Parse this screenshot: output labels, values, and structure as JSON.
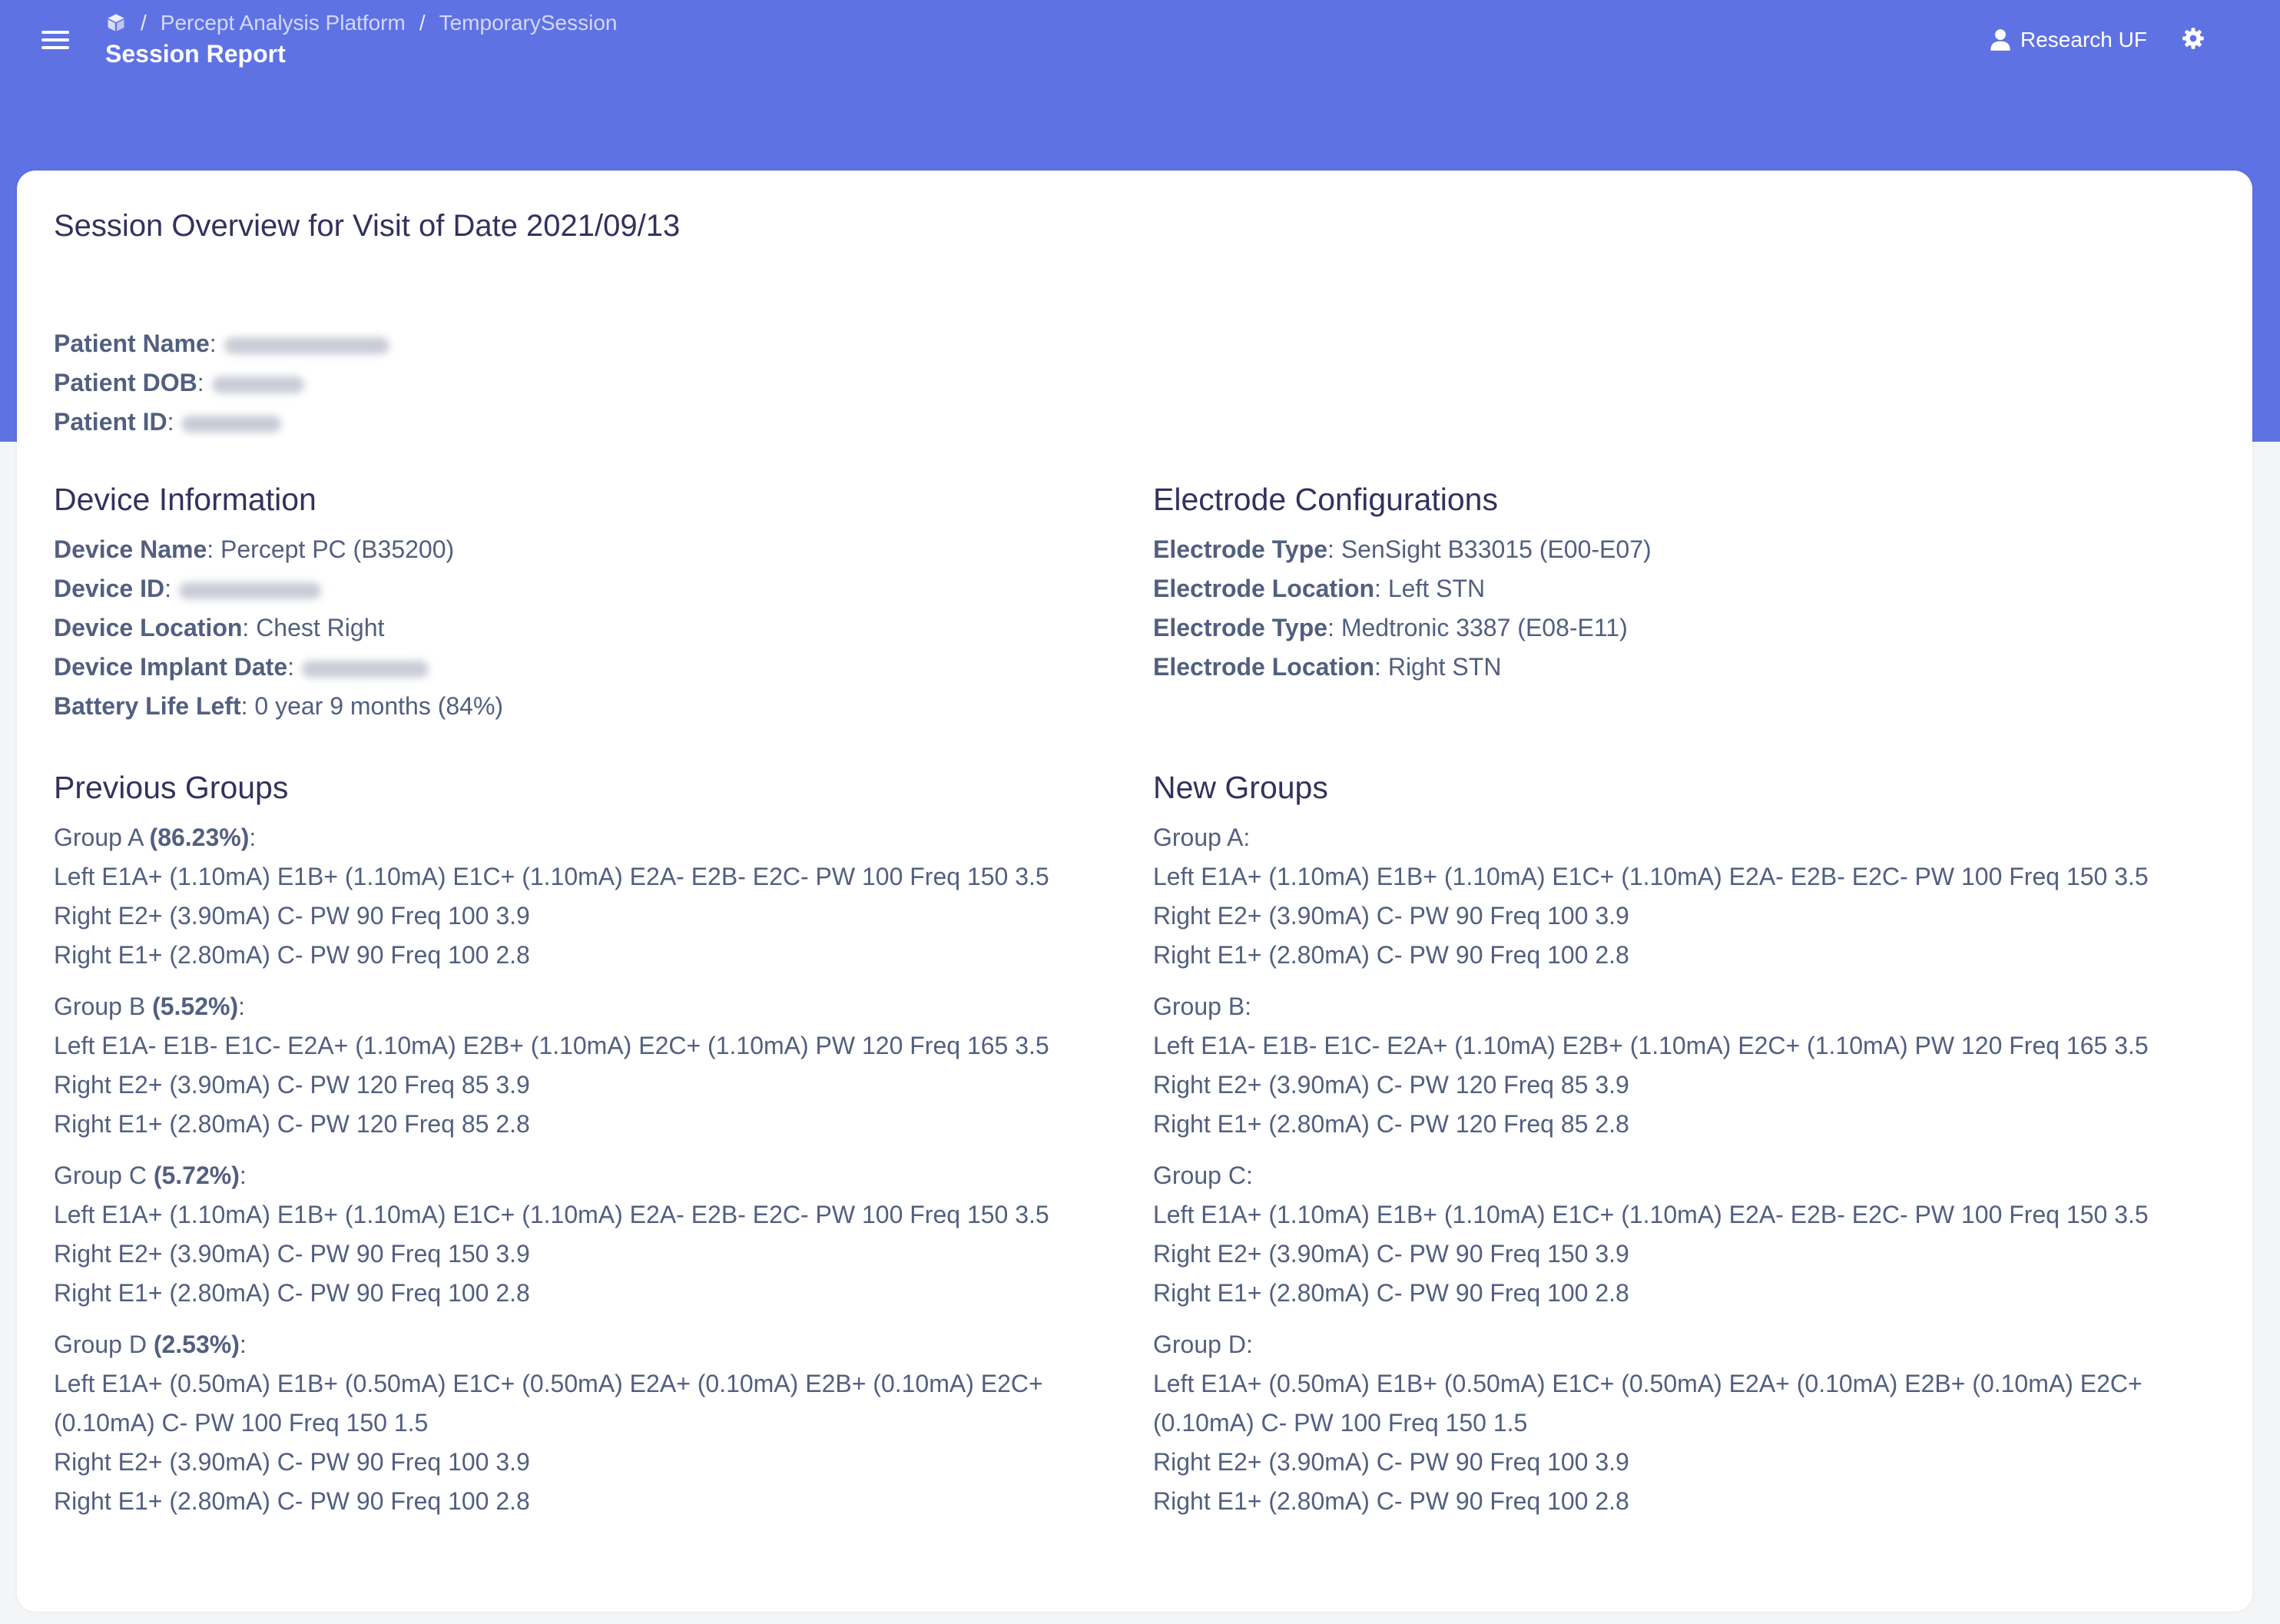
{
  "header": {
    "breadcrumb": [
      "Percept Analysis Platform",
      "TemporarySession"
    ],
    "page_title": "Session Report",
    "user_name": "Research UF"
  },
  "overview": {
    "title": "Session Overview for Visit of Date 2021/09/13"
  },
  "patient": {
    "name_label": "Patient Name",
    "dob_label": "Patient DOB",
    "id_label": "Patient ID"
  },
  "device": {
    "title": "Device Information",
    "name_label": "Device Name",
    "name_value": "Percept PC (B35200)",
    "id_label": "Device ID",
    "location_label": "Device Location",
    "location_value": "Chest Right",
    "implant_label": "Device Implant Date",
    "battery_label": "Battery Life Left",
    "battery_value": "0 year 9 months (84%)"
  },
  "electrodes": {
    "title": "Electrode Configurations",
    "items": [
      {
        "label": "Electrode Type",
        "value": "SenSight B33015 (E00-E07)"
      },
      {
        "label": "Electrode Location",
        "value": "Left STN"
      },
      {
        "label": "Electrode Type",
        "value": "Medtronic 3387 (E08-E11)"
      },
      {
        "label": "Electrode Location",
        "value": "Right STN"
      }
    ]
  },
  "previous_groups": {
    "title": "Previous Groups",
    "groups": [
      {
        "name": "Group A",
        "percent": "(86.23%)",
        "lines": [
          "Left E1A+ (1.10mA) E1B+ (1.10mA) E1C+ (1.10mA) E2A- E2B- E2C- PW 100 Freq 150 3.5",
          "Right E2+ (3.90mA) C- PW 90 Freq 100 3.9",
          "Right E1+ (2.80mA) C- PW 90 Freq 100 2.8"
        ]
      },
      {
        "name": "Group B",
        "percent": "(5.52%)",
        "lines": [
          "Left E1A- E1B- E1C- E2A+ (1.10mA) E2B+ (1.10mA) E2C+ (1.10mA) PW 120 Freq 165 3.5",
          "Right E2+ (3.90mA) C- PW 120 Freq 85 3.9",
          "Right E1+ (2.80mA) C- PW 120 Freq 85 2.8"
        ]
      },
      {
        "name": "Group C",
        "percent": "(5.72%)",
        "lines": [
          "Left E1A+ (1.10mA) E1B+ (1.10mA) E1C+ (1.10mA) E2A- E2B- E2C- PW 100 Freq 150 3.5",
          "Right E2+ (3.90mA) C- PW 90 Freq 150 3.9",
          "Right E1+ (2.80mA) C- PW 90 Freq 100 2.8"
        ]
      },
      {
        "name": "Group D",
        "percent": "(2.53%)",
        "lines": [
          "Left E1A+ (0.50mA) E1B+ (0.50mA) E1C+ (0.50mA) E2A+ (0.10mA) E2B+ (0.10mA) E2C+ (0.10mA) C- PW 100 Freq 150 1.5",
          "Right E2+ (3.90mA) C- PW 90 Freq 100 3.9",
          "Right E1+ (2.80mA) C- PW 90 Freq 100 2.8"
        ]
      }
    ]
  },
  "new_groups": {
    "title": "New Groups",
    "groups": [
      {
        "name": "Group A",
        "lines": [
          "Left E1A+ (1.10mA) E1B+ (1.10mA) E1C+ (1.10mA) E2A- E2B- E2C- PW 100 Freq 150 3.5",
          "Right E2+ (3.90mA) C- PW 90 Freq 100 3.9",
          "Right E1+ (2.80mA) C- PW 90 Freq 100 2.8"
        ]
      },
      {
        "name": "Group B",
        "lines": [
          "Left E1A- E1B- E1C- E2A+ (1.10mA) E2B+ (1.10mA) E2C+ (1.10mA) PW 120 Freq 165 3.5",
          "Right E2+ (3.90mA) C- PW 120 Freq 85 3.9",
          "Right E1+ (2.80mA) C- PW 120 Freq 85 2.8"
        ]
      },
      {
        "name": "Group C",
        "lines": [
          "Left E1A+ (1.10mA) E1B+ (1.10mA) E1C+ (1.10mA) E2A- E2B- E2C- PW 100 Freq 150 3.5",
          "Right E2+ (3.90mA) C- PW 90 Freq 150 3.9",
          "Right E1+ (2.80mA) C- PW 90 Freq 100 2.8"
        ]
      },
      {
        "name": "Group D",
        "lines": [
          "Left E1A+ (0.50mA) E1B+ (0.50mA) E1C+ (0.50mA) E2A+ (0.10mA) E2B+ (0.10mA) E2C+ (0.10mA) C- PW 100 Freq 150 1.5",
          "Right E2+ (3.90mA) C- PW 90 Freq 100 3.9",
          "Right E1+ (2.80mA) C- PW 90 Freq 100 2.8"
        ]
      }
    ]
  },
  "icons": {
    "menu": "menu-icon",
    "breadcrumb_home": "cube-icon",
    "user": "user-icon",
    "settings": "gear-icon"
  },
  "colors": {
    "header": "#5e72e4",
    "background": "#f4f5f7",
    "card": "#ffffff",
    "text": "#525f7f",
    "heading": "#32325d"
  }
}
